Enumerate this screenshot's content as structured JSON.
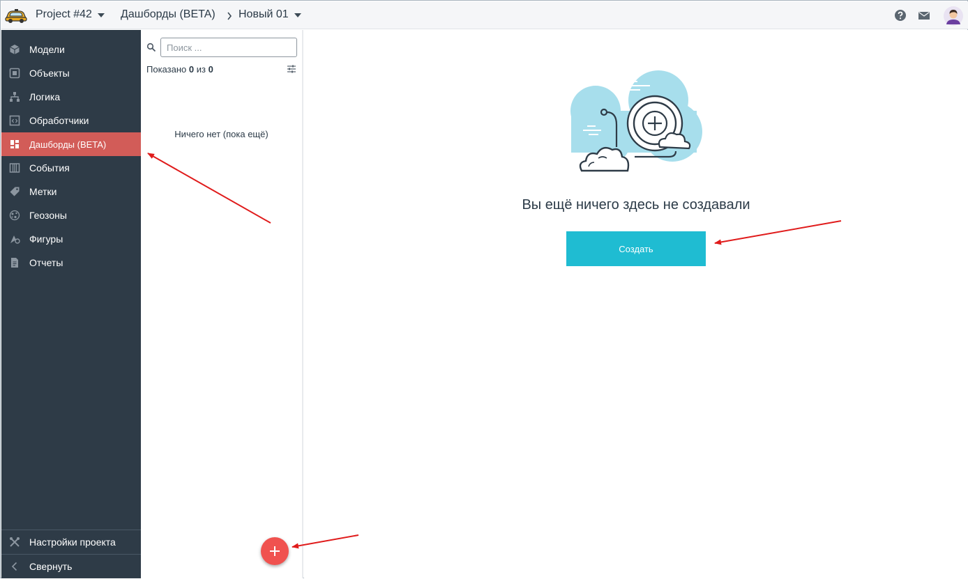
{
  "header": {
    "project": "Project #42",
    "section": "Дашборды (BETA)",
    "separator": ">",
    "current": "Новый 01"
  },
  "sidebar": {
    "items": [
      {
        "label": "Модели",
        "icon": "cube-icon"
      },
      {
        "label": "Объекты",
        "icon": "square-icon"
      },
      {
        "label": "Логика",
        "icon": "hierarchy-icon"
      },
      {
        "label": "Обработчики",
        "icon": "code-window-icon"
      },
      {
        "label": "Дашборды (BETA)",
        "icon": "dashboard-icon",
        "active": true
      },
      {
        "label": "События",
        "icon": "columns-icon"
      },
      {
        "label": "Метки",
        "icon": "tag-icon"
      },
      {
        "label": "Геозоны",
        "icon": "globe-icon"
      },
      {
        "label": "Фигуры",
        "icon": "shapes-icon"
      },
      {
        "label": "Отчеты",
        "icon": "report-icon"
      }
    ],
    "settings_label": "Настройки проекта",
    "collapse_label": "Свернуть"
  },
  "list": {
    "search_placeholder": "Поиск ...",
    "shown_prefix": "Показано",
    "shown_count": "0",
    "shown_mid": "из",
    "shown_total": "0",
    "empty_text": "Ничего нет (пока ещё)"
  },
  "main": {
    "empty_title": "Вы ещё ничего здесь не создавали",
    "create_label": "Создать"
  },
  "colors": {
    "sidebar_bg": "#2e3b47",
    "active_item": "#d25c58",
    "create_button": "#1fbcd2",
    "fab": "#f0524f",
    "annotation_arrow": "#e01b1b"
  }
}
